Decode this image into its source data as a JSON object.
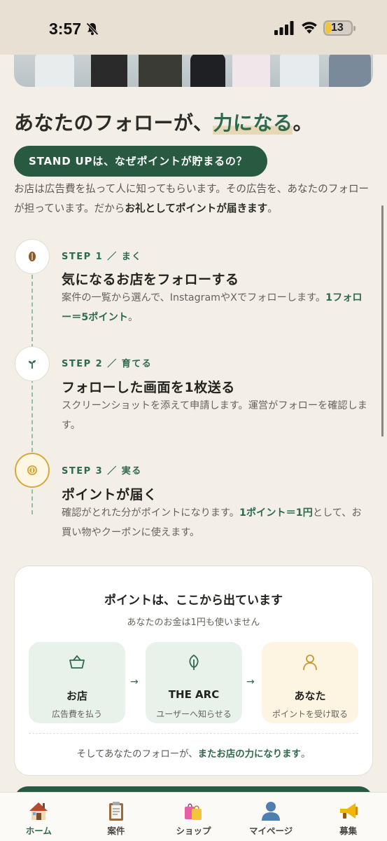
{
  "status_bar": {
    "time": "3:57",
    "battery": "13"
  },
  "headline": {
    "prefix": "あなたのフォローが、",
    "accent": "力になる",
    "suffix": "。"
  },
  "pill_label": "STAND UPは、なぜポイントが貯まるの？",
  "intro": {
    "text1": "お店は広告費を払って人に知ってもらいます。その広告を、あなたのフォローが担っています。だから",
    "bold": "お礼としてポイントが届きます",
    "text2": "。"
  },
  "steps": [
    {
      "label": "STEP 1 ／ まく",
      "title": "気になるお店をフォローする",
      "desc1": "案件の一覧から選んで、InstagramやXでフォローします。",
      "desc_bold": "1フォロー＝5ポイント",
      "desc2": "。",
      "icon": "seed-icon"
    },
    {
      "label": "STEP 2 ／ 育てる",
      "title": "フォローした画面を1枚送る",
      "desc1": "スクリーンショットを添えて申請します。運営がフォローを確認します。",
      "desc_bold": "",
      "desc2": "",
      "icon": "sprout-icon"
    },
    {
      "label": "STEP 3 ／ 実る",
      "title": "ポイントが届く",
      "desc1": "確認がとれた分がポイントになります。",
      "desc_bold": "1ポイント＝1円",
      "desc2": "として、お買い物やクーポンに使えます。",
      "icon": "coin-icon"
    }
  ],
  "card": {
    "title": "ポイントは、ここから出ています",
    "subtitle": "あなたのお金は1円も使いません",
    "flow": [
      {
        "name": "お店",
        "desc": "広告費を払う",
        "icon": "basket-icon"
      },
      {
        "name": "THE ARC",
        "desc": "ユーザーへ知らせる",
        "icon": "leaf-icon"
      },
      {
        "name": "あなた",
        "desc": "ポイントを受け取る",
        "icon": "person-icon"
      }
    ],
    "arrow": "→",
    "footer_text": "そしてあなたのフォローが、",
    "footer_bold": "またお店の力になります",
    "footer_end": "。"
  },
  "tabbar": {
    "items": [
      {
        "label": "ホーム",
        "icon": "house-icon",
        "active": true
      },
      {
        "label": "案件",
        "icon": "clipboard-icon",
        "active": false
      },
      {
        "label": "ショップ",
        "icon": "shopping-bags-icon",
        "active": false
      },
      {
        "label": "マイページ",
        "icon": "user-silhouette-icon",
        "active": false
      },
      {
        "label": "募集",
        "icon": "megaphone-icon",
        "active": false
      }
    ]
  },
  "colors": {
    "accent_green": "#275a40",
    "text_green": "#2e6a4b",
    "background": "#f3efe6",
    "gold": "#d6a93c"
  }
}
